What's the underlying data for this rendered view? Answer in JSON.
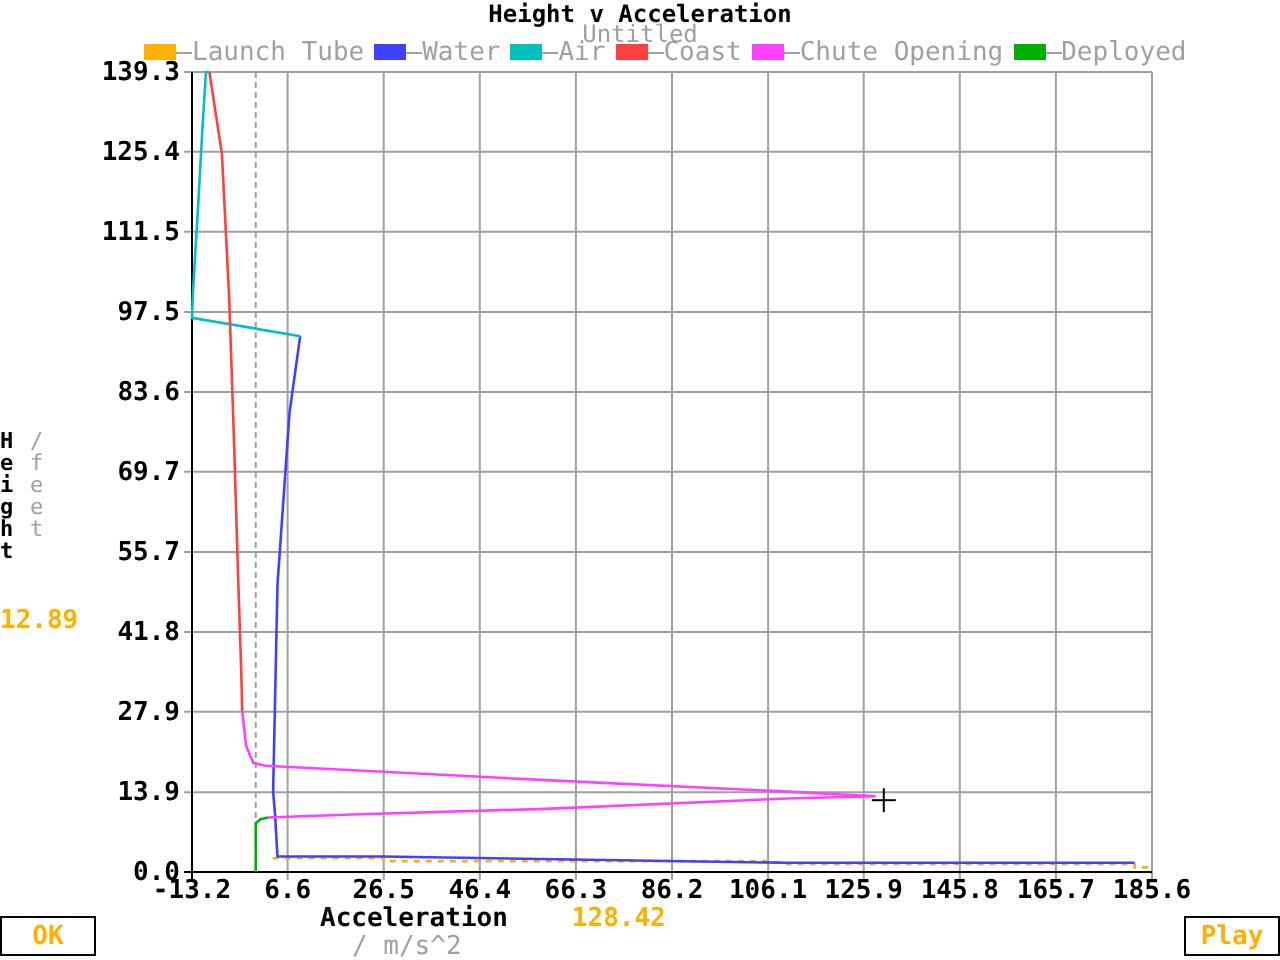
{
  "title": "Height v Acceleration",
  "subtitle": "Untitled",
  "y_axis": {
    "unit": "/ feet",
    "readout": "12.89"
  },
  "x_axis": {
    "unit": "/ m/s^2",
    "readout": "128.42"
  },
  "chart_data": {
    "type": "line",
    "xlabel": "Acceleration",
    "ylabel": "Height",
    "xlim": [
      -13.2,
      185.6
    ],
    "ylim": [
      0,
      139.3
    ],
    "grid": true,
    "ref_lines": [
      {
        "axis": "x",
        "value": 0
      }
    ],
    "xticks": [
      -13.2,
      6.6,
      26.5,
      46.4,
      66.3,
      86.2,
      106.1,
      125.9,
      145.8,
      165.7,
      185.6
    ],
    "yticks": [
      {
        "value": 0,
        "label": "0.0"
      },
      13.9,
      27.9,
      41.8,
      55.7,
      69.7,
      83.6,
      97.5,
      111.5,
      125.4,
      139.3
    ],
    "series": [
      {
        "name": "Launch Tube",
        "color": "#ffb000",
        "line_style": "dotted",
        "x": [
          3.5,
          26.5,
          26.5,
          106.1,
          110,
          182,
          182,
          185.6
        ],
        "values": [
          2.4,
          2.4,
          1.9,
          1.9,
          1.4,
          1.4,
          0.8,
          0.8
        ]
      },
      {
        "name": "Water",
        "color": "#4040ff",
        "x": [
          9.2,
          7,
          4.5,
          3.6,
          4,
          4.5,
          26,
          110,
          182
        ],
        "values": [
          93.3,
          80,
          50,
          14,
          10,
          2.7,
          2.7,
          1.6,
          1.6
        ]
      },
      {
        "name": "Air",
        "color": "#00c0c0",
        "x": [
          9.2,
          -13.2,
          -13,
          -12,
          -11,
          -10.3,
          -9.6
        ],
        "values": [
          93.3,
          96.5,
          101,
          115,
          130,
          139.3,
          139.3
        ]
      },
      {
        "name": "Coast",
        "color": "#ff4040",
        "x": [
          -9.6,
          -7,
          -5.5,
          -4.5,
          -3.6,
          -3,
          -2.8
        ],
        "values": [
          139.3,
          125,
          100,
          75,
          50,
          35,
          28
        ]
      },
      {
        "name": "Chute Opening",
        "color": "#ff40ff",
        "x": [
          -2.8,
          -2,
          -0.5,
          2,
          60,
          110,
          128.4,
          110,
          60,
          20,
          2.5
        ],
        "values": [
          28,
          22,
          19,
          18.5,
          16,
          14,
          13.2,
          12.8,
          11,
          10,
          9.5
        ]
      },
      {
        "name": "Deployed",
        "color": "#00b000",
        "x": [
          0,
          0,
          1,
          2.5
        ],
        "values": [
          0,
          8.5,
          9.2,
          9.5
        ]
      }
    ]
  },
  "buttons": [
    "OK",
    "Play"
  ]
}
